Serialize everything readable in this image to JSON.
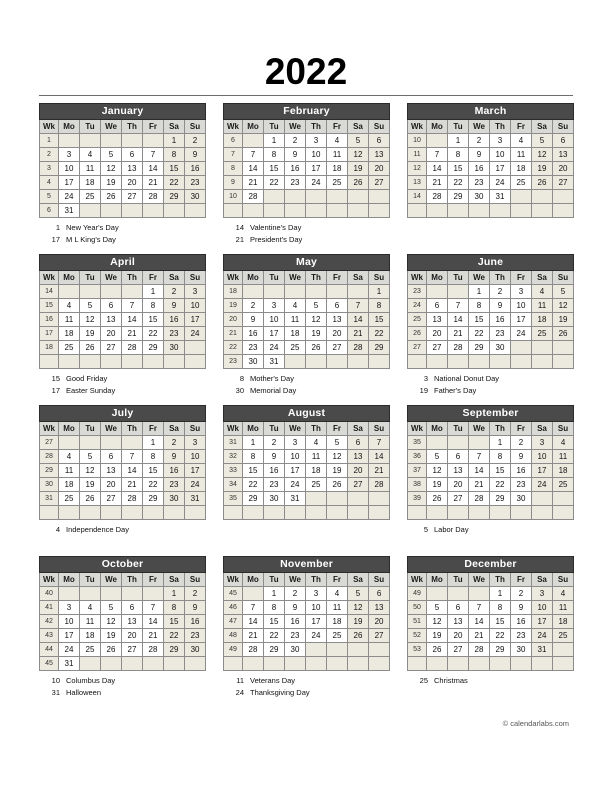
{
  "header": {
    "year": "2022"
  },
  "footer": {
    "copyright": "© calendarlabs.com"
  },
  "dow_labels": [
    "Wk",
    "Mo",
    "Tu",
    "We",
    "Th",
    "Fr",
    "Sa",
    "Su"
  ],
  "months": [
    {
      "name": "January",
      "weeks": [
        {
          "wk": "1",
          "days": [
            "",
            "",
            "",
            "",
            "",
            "1",
            "2"
          ]
        },
        {
          "wk": "2",
          "days": [
            "3",
            "4",
            "5",
            "6",
            "7",
            "8",
            "9"
          ]
        },
        {
          "wk": "3",
          "days": [
            "10",
            "11",
            "12",
            "13",
            "14",
            "15",
            "16"
          ]
        },
        {
          "wk": "4",
          "days": [
            "17",
            "18",
            "19",
            "20",
            "21",
            "22",
            "23"
          ]
        },
        {
          "wk": "5",
          "days": [
            "24",
            "25",
            "26",
            "27",
            "28",
            "29",
            "30"
          ]
        },
        {
          "wk": "6",
          "days": [
            "31",
            "",
            "",
            "",
            "",
            "",
            ""
          ]
        }
      ],
      "holidays": [
        {
          "day": "1",
          "name": "New Year's Day"
        },
        {
          "day": "17",
          "name": "M L King's Day"
        }
      ]
    },
    {
      "name": "February",
      "weeks": [
        {
          "wk": "6",
          "days": [
            "",
            "1",
            "2",
            "3",
            "4",
            "5",
            "6"
          ]
        },
        {
          "wk": "7",
          "days": [
            "7",
            "8",
            "9",
            "10",
            "11",
            "12",
            "13"
          ]
        },
        {
          "wk": "8",
          "days": [
            "14",
            "15",
            "16",
            "17",
            "18",
            "19",
            "20"
          ]
        },
        {
          "wk": "9",
          "days": [
            "21",
            "22",
            "23",
            "24",
            "25",
            "26",
            "27"
          ]
        },
        {
          "wk": "10",
          "days": [
            "28",
            "",
            "",
            "",
            "",
            "",
            ""
          ]
        },
        {
          "wk": "",
          "days": [
            "",
            "",
            "",
            "",
            "",
            "",
            ""
          ]
        }
      ],
      "holidays": [
        {
          "day": "14",
          "name": "Valentine's Day"
        },
        {
          "day": "21",
          "name": "President's Day"
        }
      ]
    },
    {
      "name": "March",
      "weeks": [
        {
          "wk": "10",
          "days": [
            "",
            "1",
            "2",
            "3",
            "4",
            "5",
            "6"
          ]
        },
        {
          "wk": "11",
          "days": [
            "7",
            "8",
            "9",
            "10",
            "11",
            "12",
            "13"
          ]
        },
        {
          "wk": "12",
          "days": [
            "14",
            "15",
            "16",
            "17",
            "18",
            "19",
            "20"
          ]
        },
        {
          "wk": "13",
          "days": [
            "21",
            "22",
            "23",
            "24",
            "25",
            "26",
            "27"
          ]
        },
        {
          "wk": "14",
          "days": [
            "28",
            "29",
            "30",
            "31",
            "",
            "",
            ""
          ]
        },
        {
          "wk": "",
          "days": [
            "",
            "",
            "",
            "",
            "",
            "",
            ""
          ]
        }
      ],
      "holidays": []
    },
    {
      "name": "April",
      "weeks": [
        {
          "wk": "14",
          "days": [
            "",
            "",
            "",
            "",
            "1",
            "2",
            "3"
          ]
        },
        {
          "wk": "15",
          "days": [
            "4",
            "5",
            "6",
            "7",
            "8",
            "9",
            "10"
          ]
        },
        {
          "wk": "16",
          "days": [
            "11",
            "12",
            "13",
            "14",
            "15",
            "16",
            "17"
          ]
        },
        {
          "wk": "17",
          "days": [
            "18",
            "19",
            "20",
            "21",
            "22",
            "23",
            "24"
          ]
        },
        {
          "wk": "18",
          "days": [
            "25",
            "26",
            "27",
            "28",
            "29",
            "30",
            ""
          ]
        },
        {
          "wk": "",
          "days": [
            "",
            "",
            "",
            "",
            "",
            "",
            ""
          ]
        }
      ],
      "holidays": [
        {
          "day": "15",
          "name": "Good Friday"
        },
        {
          "day": "17",
          "name": "Easter Sunday"
        }
      ]
    },
    {
      "name": "May",
      "weeks": [
        {
          "wk": "18",
          "days": [
            "",
            "",
            "",
            "",
            "",
            "",
            "1"
          ]
        },
        {
          "wk": "19",
          "days": [
            "2",
            "3",
            "4",
            "5",
            "6",
            "7",
            "8"
          ]
        },
        {
          "wk": "20",
          "days": [
            "9",
            "10",
            "11",
            "12",
            "13",
            "14",
            "15"
          ]
        },
        {
          "wk": "21",
          "days": [
            "16",
            "17",
            "18",
            "19",
            "20",
            "21",
            "22"
          ]
        },
        {
          "wk": "22",
          "days": [
            "23",
            "24",
            "25",
            "26",
            "27",
            "28",
            "29"
          ]
        },
        {
          "wk": "23",
          "days": [
            "30",
            "31",
            "",
            "",
            "",
            "",
            ""
          ]
        }
      ],
      "holidays": [
        {
          "day": "8",
          "name": "Mother's Day"
        },
        {
          "day": "30",
          "name": "Memorial Day"
        }
      ]
    },
    {
      "name": "June",
      "weeks": [
        {
          "wk": "23",
          "days": [
            "",
            "",
            "1",
            "2",
            "3",
            "4",
            "5"
          ]
        },
        {
          "wk": "24",
          "days": [
            "6",
            "7",
            "8",
            "9",
            "10",
            "11",
            "12"
          ]
        },
        {
          "wk": "25",
          "days": [
            "13",
            "14",
            "15",
            "16",
            "17",
            "18",
            "19"
          ]
        },
        {
          "wk": "26",
          "days": [
            "20",
            "21",
            "22",
            "23",
            "24",
            "25",
            "26"
          ]
        },
        {
          "wk": "27",
          "days": [
            "27",
            "28",
            "29",
            "30",
            "",
            "",
            ""
          ]
        },
        {
          "wk": "",
          "days": [
            "",
            "",
            "",
            "",
            "",
            "",
            ""
          ]
        }
      ],
      "holidays": [
        {
          "day": "3",
          "name": "National Donut Day"
        },
        {
          "day": "19",
          "name": "Father's Day"
        }
      ]
    },
    {
      "name": "July",
      "weeks": [
        {
          "wk": "27",
          "days": [
            "",
            "",
            "",
            "",
            "1",
            "2",
            "3"
          ]
        },
        {
          "wk": "28",
          "days": [
            "4",
            "5",
            "6",
            "7",
            "8",
            "9",
            "10"
          ]
        },
        {
          "wk": "29",
          "days": [
            "11",
            "12",
            "13",
            "14",
            "15",
            "16",
            "17"
          ]
        },
        {
          "wk": "30",
          "days": [
            "18",
            "19",
            "20",
            "21",
            "22",
            "23",
            "24"
          ]
        },
        {
          "wk": "31",
          "days": [
            "25",
            "26",
            "27",
            "28",
            "29",
            "30",
            "31"
          ]
        },
        {
          "wk": "",
          "days": [
            "",
            "",
            "",
            "",
            "",
            "",
            ""
          ]
        }
      ],
      "holidays": [
        {
          "day": "4",
          "name": "Independence Day"
        }
      ]
    },
    {
      "name": "August",
      "weeks": [
        {
          "wk": "31",
          "days": [
            "1",
            "2",
            "3",
            "4",
            "5",
            "6",
            "7"
          ]
        },
        {
          "wk": "32",
          "days": [
            "8",
            "9",
            "10",
            "11",
            "12",
            "13",
            "14"
          ]
        },
        {
          "wk": "33",
          "days": [
            "15",
            "16",
            "17",
            "18",
            "19",
            "20",
            "21"
          ]
        },
        {
          "wk": "34",
          "days": [
            "22",
            "23",
            "24",
            "25",
            "26",
            "27",
            "28"
          ]
        },
        {
          "wk": "35",
          "days": [
            "29",
            "30",
            "31",
            "",
            "",
            "",
            ""
          ]
        },
        {
          "wk": "",
          "days": [
            "",
            "",
            "",
            "",
            "",
            "",
            ""
          ]
        }
      ],
      "holidays": []
    },
    {
      "name": "September",
      "weeks": [
        {
          "wk": "35",
          "days": [
            "",
            "",
            "",
            "1",
            "2",
            "3",
            "4"
          ]
        },
        {
          "wk": "36",
          "days": [
            "5",
            "6",
            "7",
            "8",
            "9",
            "10",
            "11"
          ]
        },
        {
          "wk": "37",
          "days": [
            "12",
            "13",
            "14",
            "15",
            "16",
            "17",
            "18"
          ]
        },
        {
          "wk": "38",
          "days": [
            "19",
            "20",
            "21",
            "22",
            "23",
            "24",
            "25"
          ]
        },
        {
          "wk": "39",
          "days": [
            "26",
            "27",
            "28",
            "29",
            "30",
            "",
            ""
          ]
        },
        {
          "wk": "",
          "days": [
            "",
            "",
            "",
            "",
            "",
            "",
            ""
          ]
        }
      ],
      "holidays": [
        {
          "day": "5",
          "name": "Labor Day"
        }
      ]
    },
    {
      "name": "October",
      "weeks": [
        {
          "wk": "40",
          "days": [
            "",
            "",
            "",
            "",
            "",
            "1",
            "2"
          ]
        },
        {
          "wk": "41",
          "days": [
            "3",
            "4",
            "5",
            "6",
            "7",
            "8",
            "9"
          ]
        },
        {
          "wk": "42",
          "days": [
            "10",
            "11",
            "12",
            "13",
            "14",
            "15",
            "16"
          ]
        },
        {
          "wk": "43",
          "days": [
            "17",
            "18",
            "19",
            "20",
            "21",
            "22",
            "23"
          ]
        },
        {
          "wk": "44",
          "days": [
            "24",
            "25",
            "26",
            "27",
            "28",
            "29",
            "30"
          ]
        },
        {
          "wk": "45",
          "days": [
            "31",
            "",
            "",
            "",
            "",
            "",
            ""
          ]
        }
      ],
      "holidays": [
        {
          "day": "10",
          "name": "Columbus Day"
        },
        {
          "day": "31",
          "name": "Halloween"
        }
      ]
    },
    {
      "name": "November",
      "weeks": [
        {
          "wk": "45",
          "days": [
            "",
            "1",
            "2",
            "3",
            "4",
            "5",
            "6"
          ]
        },
        {
          "wk": "46",
          "days": [
            "7",
            "8",
            "9",
            "10",
            "11",
            "12",
            "13"
          ]
        },
        {
          "wk": "47",
          "days": [
            "14",
            "15",
            "16",
            "17",
            "18",
            "19",
            "20"
          ]
        },
        {
          "wk": "48",
          "days": [
            "21",
            "22",
            "23",
            "24",
            "25",
            "26",
            "27"
          ]
        },
        {
          "wk": "49",
          "days": [
            "28",
            "29",
            "30",
            "",
            "",
            "",
            ""
          ]
        },
        {
          "wk": "",
          "days": [
            "",
            "",
            "",
            "",
            "",
            "",
            ""
          ]
        }
      ],
      "holidays": [
        {
          "day": "11",
          "name": "Veterans Day"
        },
        {
          "day": "24",
          "name": "Thanksgiving Day"
        }
      ]
    },
    {
      "name": "December",
      "weeks": [
        {
          "wk": "49",
          "days": [
            "",
            "",
            "",
            "1",
            "2",
            "3",
            "4"
          ]
        },
        {
          "wk": "50",
          "days": [
            "5",
            "6",
            "7",
            "8",
            "9",
            "10",
            "11"
          ]
        },
        {
          "wk": "51",
          "days": [
            "12",
            "13",
            "14",
            "15",
            "16",
            "17",
            "18"
          ]
        },
        {
          "wk": "52",
          "days": [
            "19",
            "20",
            "21",
            "22",
            "23",
            "24",
            "25"
          ]
        },
        {
          "wk": "53",
          "days": [
            "26",
            "27",
            "28",
            "29",
            "30",
            "31",
            ""
          ]
        },
        {
          "wk": "",
          "days": [
            "",
            "",
            "",
            "",
            "",
            "",
            ""
          ]
        }
      ],
      "holidays": [
        {
          "day": "25",
          "name": "Christmas"
        }
      ]
    }
  ]
}
